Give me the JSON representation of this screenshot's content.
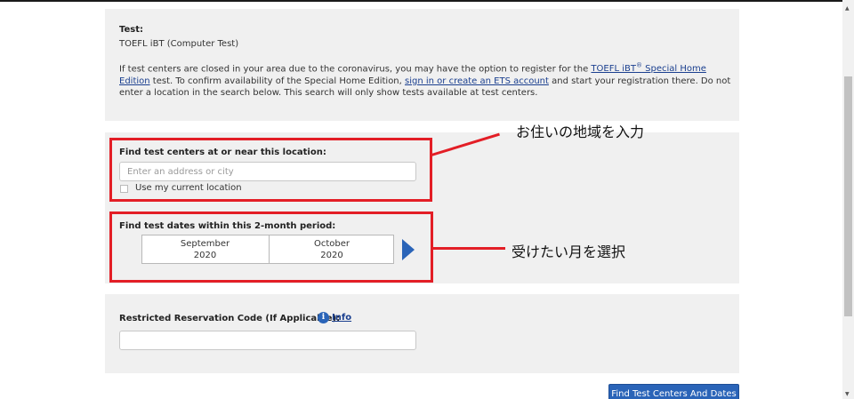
{
  "test_info": {
    "label": "Test:",
    "value": "TOEFL iBT (Computer Test)",
    "para_1": "If test centers are closed in your area due to the coronavirus, you may have the option to register for the ",
    "link_home_edition": "TOEFL iBT",
    "sup": "®",
    "link_home_edition_2": " Special Home Edition",
    "para_2": " test. To confirm availability of the Special Home Edition, ",
    "link_sign_in": "sign in or create an ETS account",
    "para_3": " and start your registration there. Do not enter a location in the search below. This search will only show tests available at test centers."
  },
  "location": {
    "label": "Find test centers at or near this location:",
    "placeholder": "Enter an address or city",
    "current_location_label": "Use my current location"
  },
  "dates": {
    "label": "Find test dates within this 2-month period:",
    "months": [
      {
        "month": "September",
        "year": "2020"
      },
      {
        "month": "October",
        "year": "2020"
      }
    ],
    "next_icon": "next-arrow-icon"
  },
  "reservation": {
    "label": "Restricted Reservation Code (If Applicable):",
    "info_link": "Info",
    "info_icon_glyph": "i"
  },
  "submit_button": "Find Test Centers And Dates",
  "annotations": {
    "location_note": "お住いの地域を入力",
    "month_note": "受けたい月を選択"
  },
  "colors": {
    "accent": "#2a64b8",
    "annotation_red": "#e31e26",
    "panel_bg": "#f0f0f0"
  }
}
